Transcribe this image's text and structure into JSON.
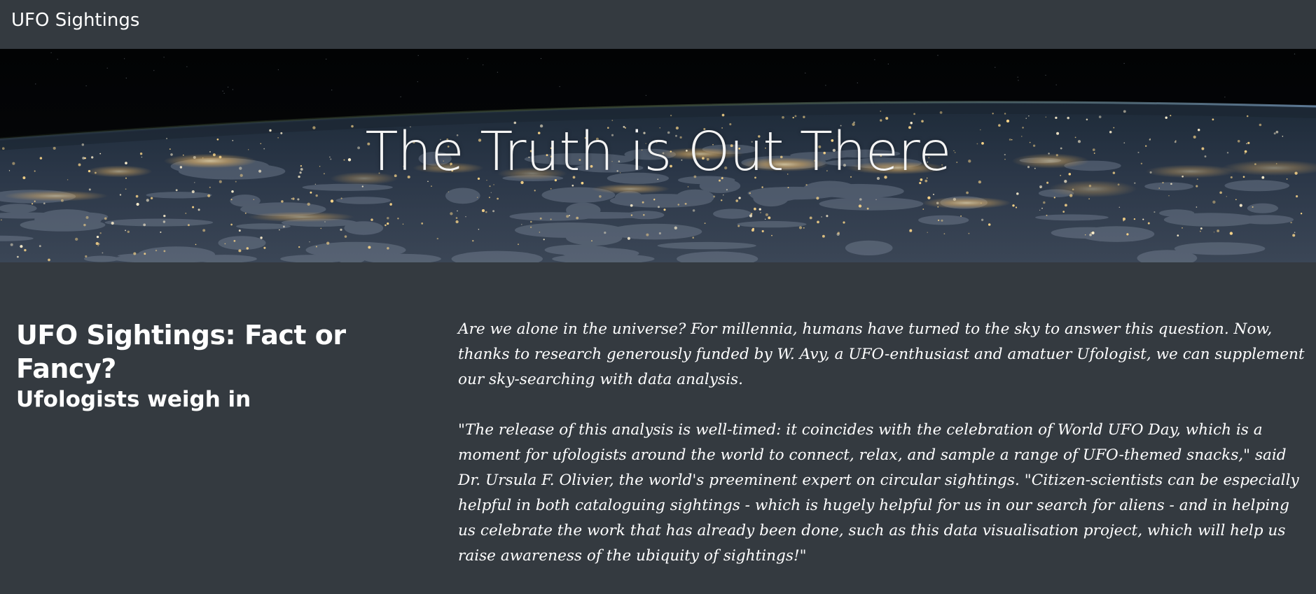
{
  "navbar": {
    "brand": "UFO Sightings"
  },
  "hero": {
    "title": "The Truth is Out There"
  },
  "article": {
    "heading": "UFO Sightings: Fact or Fancy?",
    "subheading": "Ufologists weigh in",
    "paragraphs": [
      "Are we alone in the universe? For millennia, humans have turned to the sky to answer this question. Now, thanks to research generously funded by W. Avy, a UFO-enthusiast and amatuer Ufologist, we can supplement our sky-searching with data analysis.",
      "\"The release of this analysis is well-timed: it coincides with the celebration of World UFO Day, which is a moment for ufologists around the world to connect, relax, and sample a range of UFO-themed snacks,\" said Dr. Ursula F. Olivier, the world's preeminent expert on circular sightings. \"Citizen-scientists can be especially helpful in both cataloguing sightings - which is hugely helpful for us in our search for aliens - and in helping us celebrate the work that has already been done, such as this data visualisation project, which will help us raise awareness of the ubiquity of sightings!\""
    ]
  },
  "colors": {
    "background": "#343a40",
    "text": "#ffffff"
  }
}
